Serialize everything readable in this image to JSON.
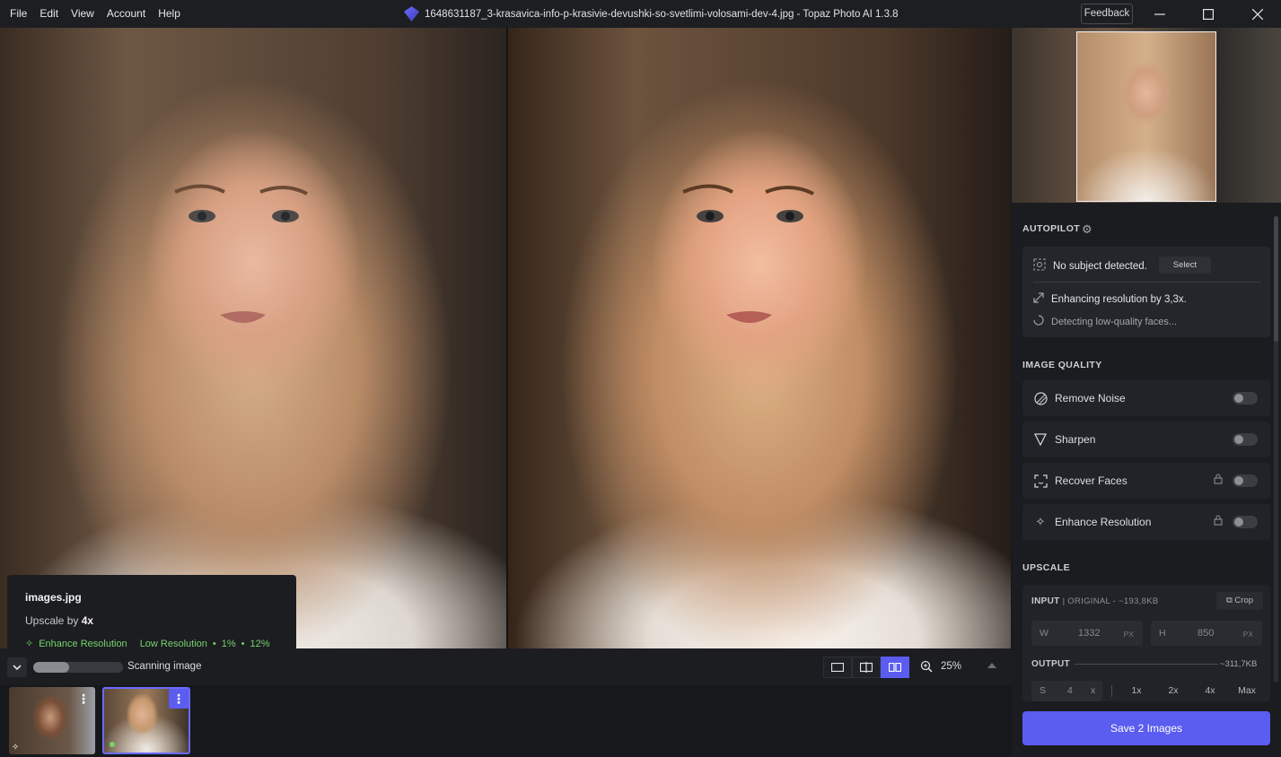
{
  "menu": [
    "File",
    "Edit",
    "View",
    "Account",
    "Help"
  ],
  "window_title": "1648631187_3-krasavica-info-p-krasivie-devushki-so-svetlimi-volosami-dev-4.jpg - Topaz Photo AI 1.3.8",
  "feedback_label": "Feedback",
  "window_controls": [
    "minimize-icon",
    "maximize-icon",
    "close-icon"
  ],
  "info_card": {
    "filename": "images.jpg",
    "upscale_prefix": "Upscale by",
    "upscale_value": "4x",
    "model": "Enhance Resolution",
    "tag": "Low Resolution",
    "pct1": "1%",
    "pct2": "12%"
  },
  "bottom_bar": {
    "status": "Scanning image",
    "progress": 0.4,
    "zoom": "25%"
  },
  "autopilot": {
    "title": "AUTOPILOT",
    "subject": "No subject detected.",
    "select_label": "Select",
    "enhancing": "Enhancing resolution by 3,3x.",
    "detecting": "Detecting low-quality faces..."
  },
  "image_quality": {
    "title": "IMAGE QUALITY",
    "items": [
      {
        "label": "Remove Noise",
        "locked": false,
        "on": false
      },
      {
        "label": "Sharpen",
        "locked": false,
        "on": false
      },
      {
        "label": "Recover Faces",
        "locked": true,
        "on": false
      },
      {
        "label": "Enhance Resolution",
        "locked": true,
        "on": false
      }
    ]
  },
  "upscale": {
    "title": "UPSCALE",
    "input_label": "INPUT",
    "input_meta": "| ORIGINAL - ~193,8KB",
    "crop_label": "Crop",
    "width_letter": "W",
    "width": "1332",
    "height_letter": "H",
    "height": "850",
    "unit": "PX",
    "output_label": "OUTPUT",
    "output_size": "~311,7KB",
    "scale_letter": "S",
    "scale_value": "4",
    "scale_unit": "x",
    "scale_options": [
      "1x",
      "2x",
      "4x",
      "Max"
    ]
  },
  "save_label": "Save 2 Images",
  "colors": {
    "accent": "#5b5cf0",
    "success": "#74d36b"
  }
}
